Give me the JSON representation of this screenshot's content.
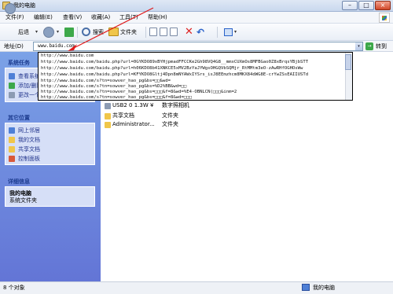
{
  "window": {
    "title": "我的电脑",
    "min": "–",
    "max": "□",
    "close": "×"
  },
  "menu": [
    "文件(F)",
    "编辑(E)",
    "查看(V)",
    "收藏(A)",
    "工具(T)",
    "帮助(H)"
  ],
  "toolbar": {
    "back": "后退",
    "search": "搜索",
    "folders": "文件夹",
    "drop": "▾"
  },
  "address": {
    "label": "地址(D)",
    "value": "www.baidu.com",
    "go": "转到",
    "go_arrow": "→"
  },
  "dropdown_items": [
    "http://www.baidu.com",
    "http://www.baidu.com/baidu.php?url=0GYKDO89xBYHjpmadFFCCKe2Gh98VQ4G8__mmxCUXmOs8MFBGao0Z8xBrqsYBjbSTT",
    "http://www.baidu.com/baidu.php?url=h06KDO8b41XNKCE5xMV2BzYaJYWgsOHGQVbSQMjr_RtMMtm3eO-zAwRHfOGHOsWw",
    "http://www.baidu.com/baidu.php?url=KFYKDO8Gltj4Dpn8mNYAWxIYSrs_isJ8EEmzhcm8MKX84dWG8E-crYwZSsEAIIUSTd",
    "http://www.baidu.com/s?tn=sowver_hao_pg&bs=□□&wd=",
    "http://www.baidu.com/s?tn=sowver_hao_pg&bs=%D2%BB&wd=□□",
    "http://www.baidu.com/s?tn=sowver_hao_pg&bs=□□□&f=8&wd=%E4-OBNLCN(□□□&inm=2",
    "http://www.baidu.com/s?tn=sowver_hao_pg&bs=□□□&f=8&wd=□□□"
  ],
  "left_panel": {
    "system_tasks": {
      "title": "系统任务",
      "items": [
        "查看系统信息",
        "添加/删除程序",
        "更改一个设置"
      ]
    },
    "other_places": {
      "title": "其它位置",
      "items": [
        "网上邻居",
        "我的文档",
        "共享文档",
        "控制面板"
      ]
    },
    "details": {
      "title": "详细信息",
      "name": "我的电脑",
      "desc": "系统文件夹"
    }
  },
  "main": {
    "partial_row": {
      "name": "USB2 0 1.3W ¥",
      "type": "数字照相机"
    },
    "items": [
      {
        "name": "共享文档",
        "type": "文件夹"
      },
      {
        "name": "Administrator...",
        "type": "文件夹"
      }
    ]
  },
  "status": {
    "left": "8 个对象",
    "right": "我的电脑"
  },
  "colors": {
    "accent": "#2a62c9",
    "annotation": "#e01a1a",
    "panel_top": "#7ba2e7",
    "panel_bottom": "#6375d6"
  }
}
